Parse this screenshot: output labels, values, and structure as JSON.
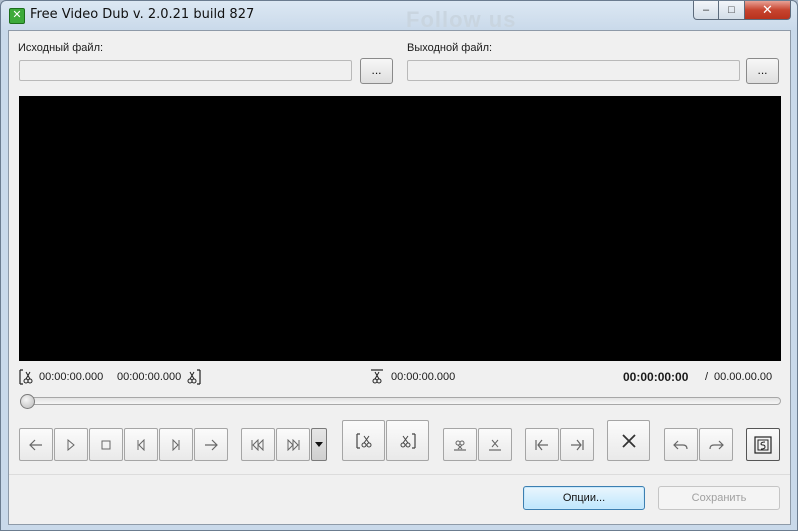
{
  "window": {
    "title": "Free Video Dub  v. 2.0.21 build 827",
    "minimize_glyph": "‒",
    "maximize_glyph": "□",
    "close_glyph": "✕"
  },
  "background": {
    "overlay_text": "Follow us"
  },
  "source": {
    "label": "Исходный файл:",
    "value": "",
    "browse_label": "..."
  },
  "output": {
    "label": "Выходной файл:",
    "value": "",
    "browse_label": "..."
  },
  "timeline": {
    "selection_start": "00:00:00.000",
    "selection_end": "00:00:00.000",
    "marker_time": "00:00:00.000",
    "current_time": "00:00:00:00",
    "separator": "/",
    "total_time": "00.00.00.00",
    "slider_position": 0
  },
  "toolbar": {
    "icons": [
      "arrow-left-icon",
      "play-icon",
      "stop-icon",
      "step-back-icon",
      "step-forward-icon",
      "arrow-right-icon",
      "skip-to-start-icon",
      "skip-to-end-icon",
      "dropdown-arrow-icon",
      "cut-start-icon",
      "cut-end-icon",
      "mark-in-icon",
      "mark-out-icon",
      "go-to-start-marker-icon",
      "go-to-end-marker-icon",
      "delete-icon",
      "undo-icon",
      "redo-icon",
      "scene-detect-icon"
    ]
  },
  "footer": {
    "options_label": "Опции...",
    "save_label": "Сохранить"
  },
  "colors": {
    "video_bg": "#000000",
    "titlebar": "#dce8f3",
    "client_bg": "#f0f0f0",
    "close_button": "#c7442f",
    "focused_button_border": "#3c7fb1"
  }
}
